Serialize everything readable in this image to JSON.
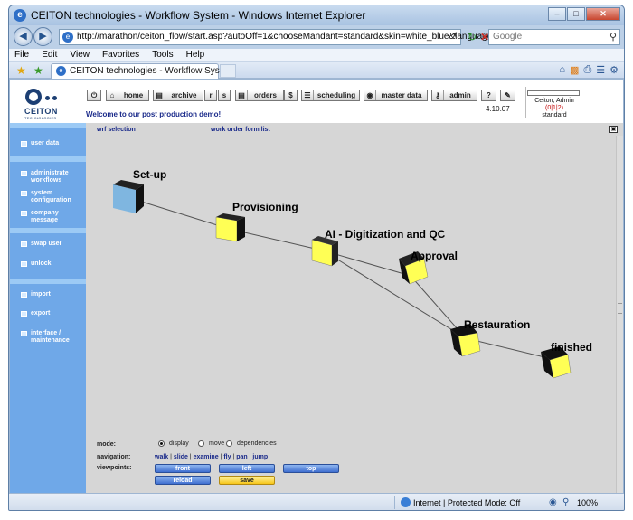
{
  "browser": {
    "title": "CEITON technologies - Workflow System - Windows Internet Explorer",
    "url": "http://marathon/ceiton_flow/start.asp?autoOff=1&chooseMandant=standard&skin=white_blue&language=de",
    "search_placeholder": "Google",
    "menu": [
      "File",
      "Edit",
      "View",
      "Favorites",
      "Tools",
      "Help"
    ],
    "tab_title": "CEITON technologies - Workflow System",
    "status_zone": "Internet | Protected Mode: Off",
    "zoom": "100%"
  },
  "app": {
    "logo_text": "CEITON",
    "logo_sub": "TECHNOLOGIES",
    "toolbar": {
      "home": "home",
      "archive": "archive",
      "r": "r",
      "s": "s",
      "orders": "orders",
      "dollar": "$",
      "scheduling": "scheduling",
      "master_data": "master data",
      "admin": "admin",
      "help": "?"
    },
    "welcome": "Welcome to our post production demo!",
    "date": "4.10.07",
    "user": {
      "name": "Ceiton, Admin",
      "links": "(0|1|2)",
      "role": "standard"
    }
  },
  "sidebar": {
    "items": [
      {
        "label": "user data"
      },
      {
        "label": "administrate workflows"
      },
      {
        "label": "system configuration"
      },
      {
        "label": "company message"
      },
      {
        "label": "swap user"
      },
      {
        "label": "unlock"
      },
      {
        "label": "import"
      },
      {
        "label": "export"
      },
      {
        "label": "interface / maintenance"
      }
    ]
  },
  "main": {
    "links": {
      "wrf_selection": "wrf selection",
      "form_list": "work order form list"
    },
    "nodes": [
      {
        "label": "Set-up"
      },
      {
        "label": "Provisioning"
      },
      {
        "label": "AI - Digitization and QC"
      },
      {
        "label": "Approval"
      },
      {
        "label": "Restauration"
      },
      {
        "label": "finished"
      }
    ],
    "controls": {
      "mode_label": "mode:",
      "modes": [
        "display",
        "move",
        "dependencies"
      ],
      "selected_mode": "display",
      "navigation_label": "navigation:",
      "navigation": [
        "walk",
        "slide",
        "examine",
        "fly",
        "pan",
        "jump"
      ],
      "viewpoints_label": "viewpoints:",
      "viewpoints": [
        "front",
        "left",
        "top"
      ],
      "reload": "reload",
      "save": "save"
    }
  },
  "colors": {
    "sidebar": "#6fa8e8",
    "canvas": "#d6d6d6",
    "node_active": "#ffff55",
    "node_start": "#7fb6e0",
    "save_button": "#f7c518"
  }
}
